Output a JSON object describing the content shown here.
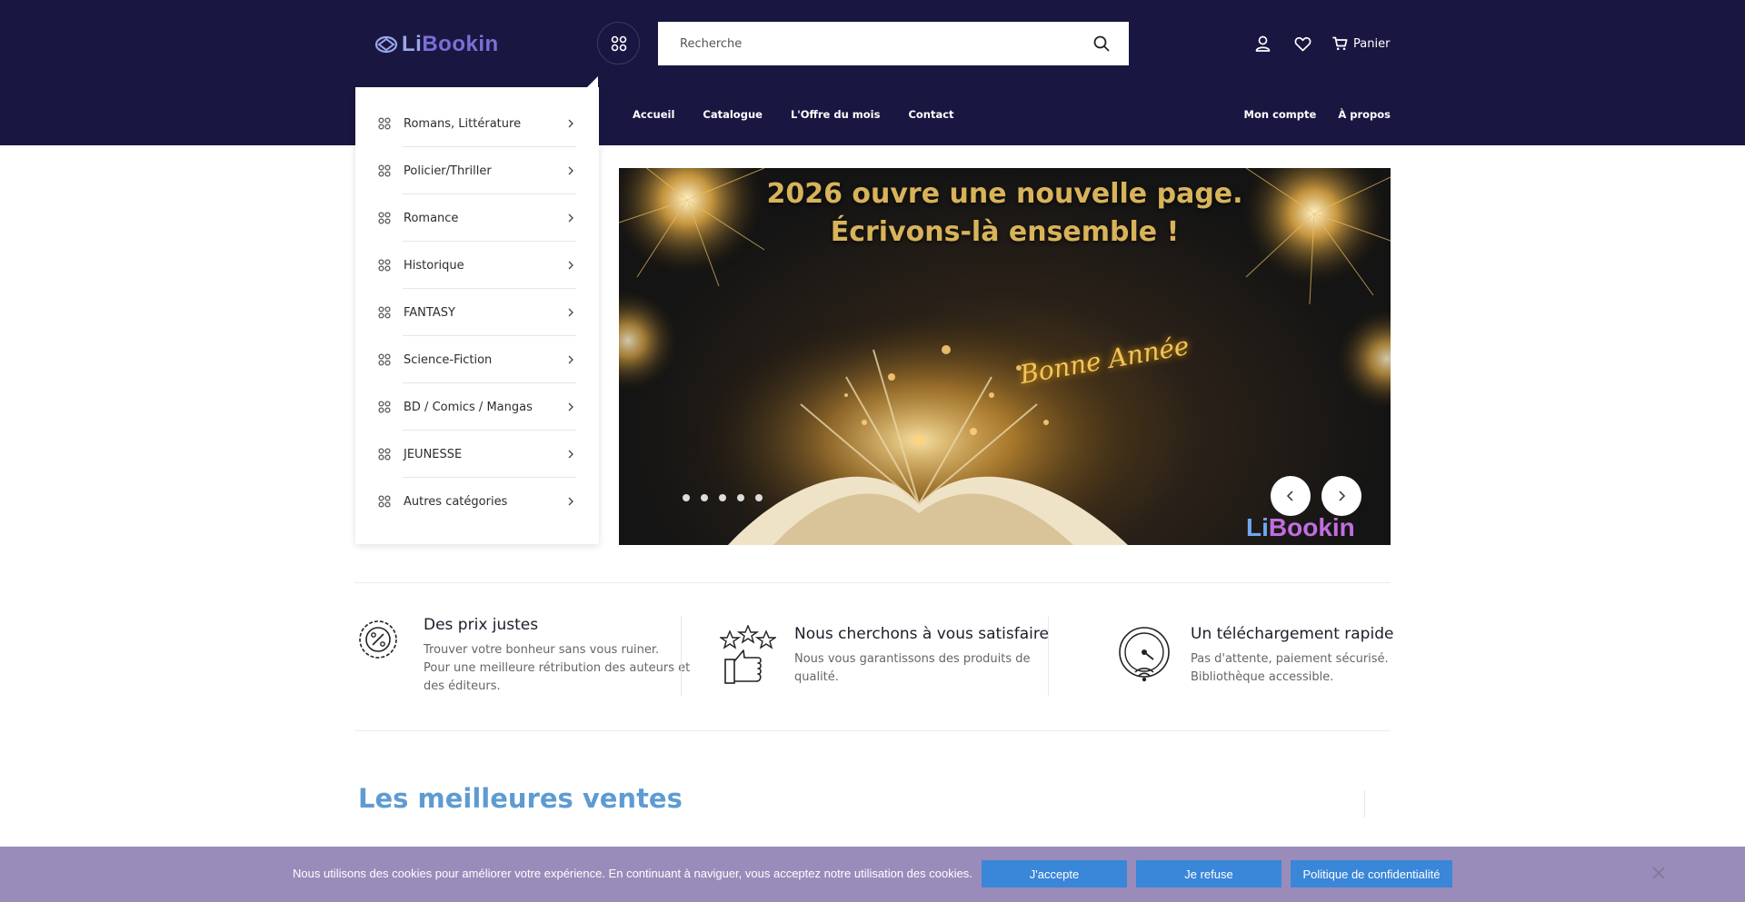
{
  "brand": {
    "logo_part1": "Li",
    "logo_part2": "Bookin"
  },
  "search": {
    "placeholder": "Recherche"
  },
  "header": {
    "cart_label": "Panier"
  },
  "nav": {
    "items": [
      {
        "label": "Accueil"
      },
      {
        "label": "Catalogue"
      },
      {
        "label": "L'Offre du mois"
      },
      {
        "label": "Contact"
      }
    ],
    "right": [
      {
        "label": "Mon compte"
      },
      {
        "label": "À propos"
      }
    ]
  },
  "categories": [
    {
      "label": "Romans, Littérature"
    },
    {
      "label": "Policier/Thriller"
    },
    {
      "label": "Romance"
    },
    {
      "label": "Historique"
    },
    {
      "label": "FANTASY"
    },
    {
      "label": "Science-Fiction"
    },
    {
      "label": "BD / Comics / Mangas"
    },
    {
      "label": "JEUNESSE"
    },
    {
      "label": "Autres catégories"
    }
  ],
  "banner": {
    "headline_line1": "2026 ouvre une nouvelle page.",
    "headline_line2": "Écrivons-là ensemble !",
    "script_text": "Bonne Année",
    "logo_part1": "Li",
    "logo_part2": "Bookin",
    "slide_count": 5
  },
  "features": [
    {
      "icon": "discount-badge-icon",
      "title": "Des prix justes",
      "desc_lines": [
        "Trouver votre bonheur sans vous ruiner.",
        "Pour une meilleure rétribution des auteurs et",
        "des éditeurs."
      ]
    },
    {
      "icon": "thumbs-up-stars-icon",
      "title": "Nous cherchons à vous satisfaire",
      "desc_lines": [
        "Nous vous garantissons des produits de",
        "qualité."
      ]
    },
    {
      "icon": "speed-download-icon",
      "title": "Un téléchargement rapide",
      "desc_lines": [
        "Pas d'attente, paiement sécurisé.",
        "Bibliothèque accessible."
      ]
    }
  ],
  "sections": {
    "best_sellers_title": "Les meilleures ventes"
  },
  "cookie": {
    "text": "Nous utilisons des cookies pour améliorer votre expérience. En continuant à naviguer, vous acceptez notre utilisation des cookies.",
    "accept_label": "J'accepte",
    "refuse_label": "Je refuse",
    "policy_label": "Politique de confidentialité"
  },
  "colors": {
    "header_bg": "#191741",
    "accent_blue": "#5e9bd2",
    "cookie_bg": "#9a8cba",
    "cookie_button": "#3a86d8"
  }
}
